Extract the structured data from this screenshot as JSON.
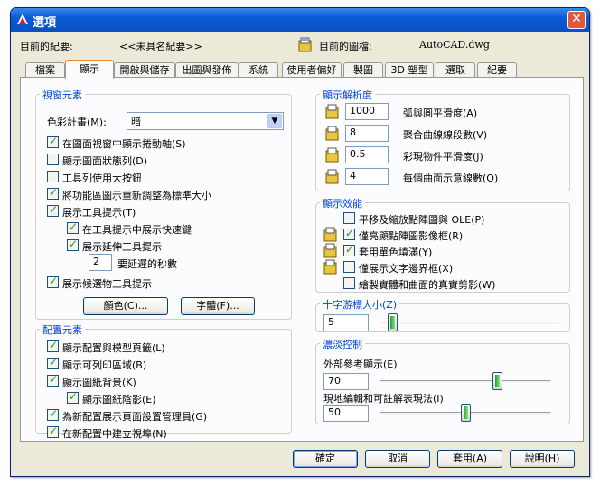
{
  "window": {
    "title": "選項"
  },
  "info": {
    "current_profile_label": "目前的紀要:",
    "current_profile_value": "<<未具名紀要>>",
    "current_drawing_label": "目前的圖檔:",
    "current_drawing_value": "AutoCAD.dwg"
  },
  "tabs": [
    "檔案",
    "顯示",
    "開啟與儲存",
    "出圖與發佈",
    "系統",
    "使用者偏好",
    "製圖",
    "3D 塑型",
    "選取",
    "紀要"
  ],
  "active_tab": "顯示",
  "window_elements": {
    "title": "視窗元素",
    "color_scheme_label": "色彩計畫(M):",
    "color_scheme_value": "暗",
    "scrollbars": "在圖面視窗中顯示捲動軸(S)",
    "status_bar": "顯示圖面狀態列(D)",
    "large_buttons": "工具列使用大按鈕",
    "resize_icons": "將功能區圖示重新調整為標準大小",
    "tooltips": "展示工具提示(T)",
    "shortcut_keys": "在工具提示中展示快速鍵",
    "extended_tooltips": "展示延伸工具提示",
    "delay_value": "2",
    "delay_label": "要延遲的秒數",
    "rollover_tooltips": "展示候選物工具提示",
    "colors_button": "顏色(C)...",
    "fonts_button": "字體(F)..."
  },
  "layout_elements": {
    "title": "配置元素",
    "layout_tabs": "顯示配置與模型頁籤(L)",
    "printable_area": "顯示可列印區域(B)",
    "paper_background": "顯示圖紙背景(K)",
    "paper_shadow": "顯示圖紙陰影(E)",
    "page_setup_manager": "為新配置展示頁面設置管理員(G)",
    "create_viewport": "在新配置中建立視埠(N)"
  },
  "resolution": {
    "title": "顯示解析度",
    "arc_smoothness_value": "1000",
    "arc_smoothness_label": "弧與圓平滑度(A)",
    "polyline_segments_value": "8",
    "polyline_segments_label": "聚合曲線線段數(V)",
    "rendered_smoothness_value": "0.5",
    "rendered_smoothness_label": "彩現物件平滑度(J)",
    "contour_lines_value": "4",
    "contour_lines_label": "每個曲面示意線數(O)"
  },
  "performance": {
    "title": "顯示效能",
    "pan_zoom_ole": "平移及縮放點陣圖與 OLE(P)",
    "highlight_raster": "僅亮顯點陣圖影像框(R)",
    "true_color_fill": "套用單色填滿(Y)",
    "text_boundary": "僅展示文字邊界框(X)",
    "silhouettes": "繪製實體和曲面的真實剪影(W)"
  },
  "crosshair": {
    "title": "十字游標大小(Z)",
    "value": "5",
    "level_fraction": 0.05
  },
  "fade": {
    "title": "濃淡控制",
    "xref_label": "外部參考顯示(E)",
    "xref_value": "70",
    "xref_fraction": 0.7,
    "inplace_label": "現地編輯和可註解表現法(I)",
    "inplace_value": "50",
    "inplace_fraction": 0.5
  },
  "buttons": {
    "ok": "確定",
    "cancel": "取消",
    "apply": "套用(A)",
    "help": "說明(H)"
  },
  "checkbox_states": {
    "scrollbars": true,
    "status_bar": false,
    "large_buttons": false,
    "resize_icons": true,
    "tooltips": true,
    "shortcut_keys": true,
    "extended_tooltips": true,
    "rollover_tooltips": true,
    "layout_tabs": true,
    "printable_area": true,
    "paper_background": true,
    "paper_shadow": true,
    "page_setup_manager": true,
    "create_viewport": true,
    "pan_zoom_ole": false,
    "highlight_raster": true,
    "true_color_fill": true,
    "text_boundary": false,
    "silhouettes": false
  },
  "colors": {
    "title_bar": "#0b5bd7",
    "group_title": "#0046d5",
    "active_tab_accent": "#e68b2c"
  }
}
